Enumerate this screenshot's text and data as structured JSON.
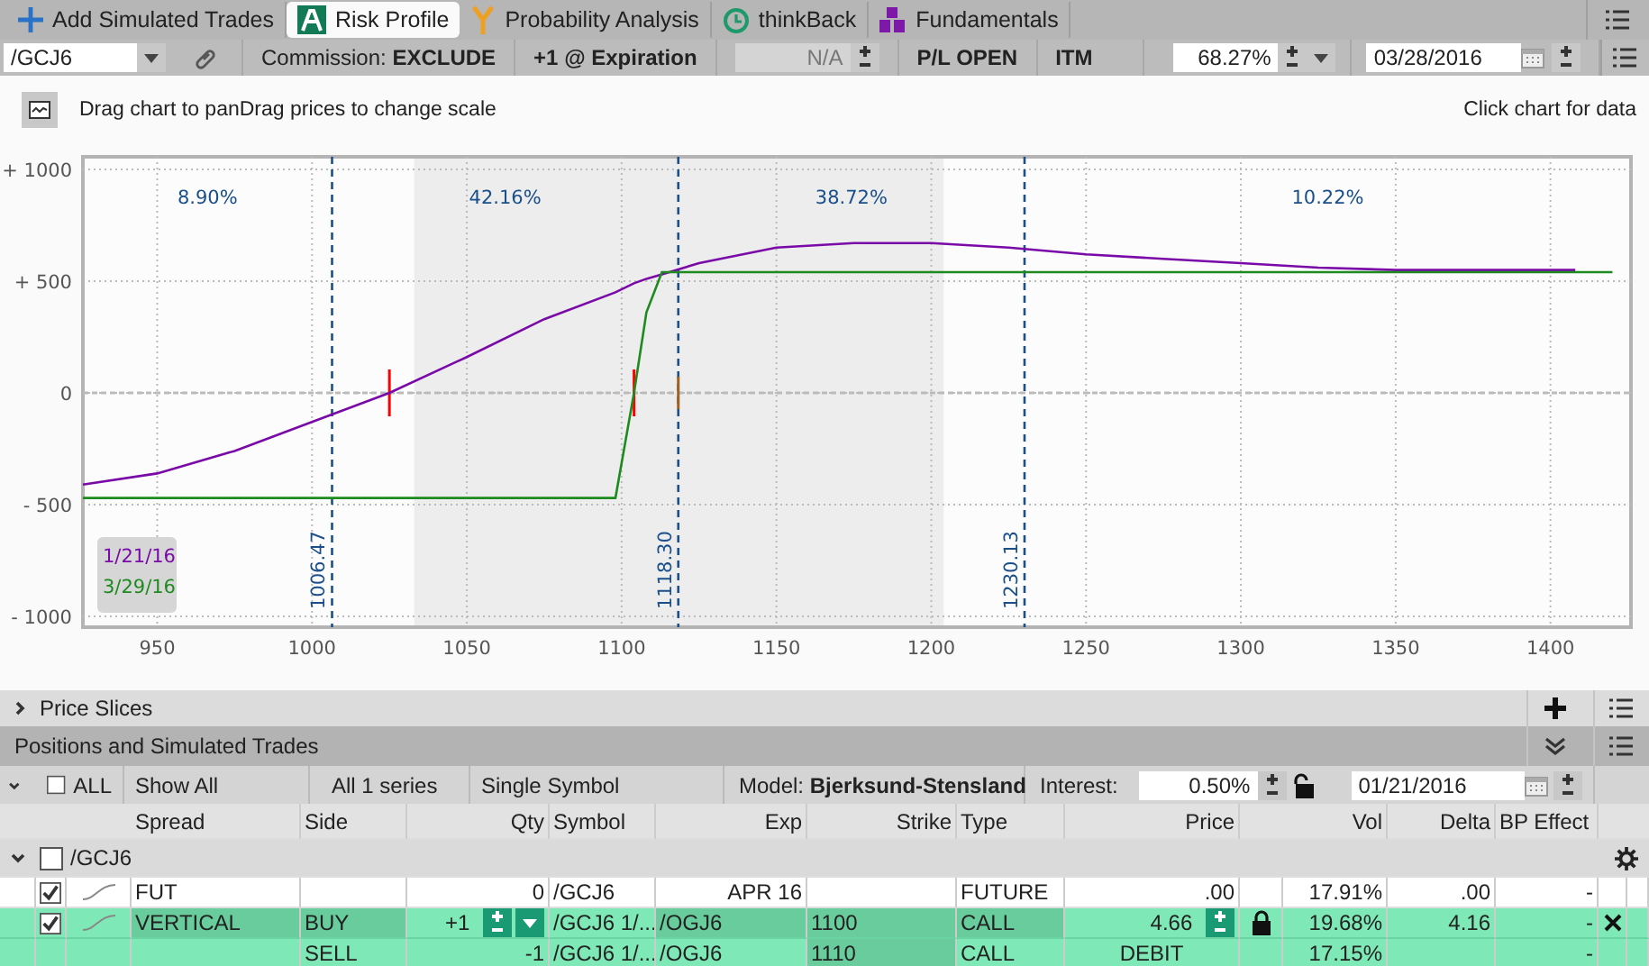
{
  "add_button": {
    "label": "Add Simulated Trades"
  },
  "tabs": [
    {
      "label": "Risk Profile",
      "selected": true
    },
    {
      "label": "Probability Analysis",
      "selected": false
    },
    {
      "label": "thinkBack",
      "selected": false
    },
    {
      "label": "Fundamentals",
      "selected": false
    }
  ],
  "toolbar": {
    "symbol": {
      "value": "/GCJ6"
    },
    "commission": {
      "label": "Commission:",
      "value": "EXCLUDE"
    },
    "expiration": "+1 @ Expiration",
    "offset": {
      "value": "N/A",
      "disabled": true
    },
    "pl_mode": "P/L OPEN",
    "itm": "ITM",
    "probability": {
      "value": "68.27%"
    },
    "date": {
      "value": "03/28/2016"
    }
  },
  "chart": {
    "hint": "Drag chart to panDrag prices to change scale",
    "click_hint": "Click chart for data",
    "chart_data": {
      "type": "line",
      "x": [
        926,
        950,
        975,
        1000,
        1025,
        1050,
        1075,
        1098,
        1104,
        1108,
        1113,
        1125,
        1150,
        1175,
        1200,
        1225,
        1250,
        1275,
        1300,
        1325,
        1350,
        1375,
        1408,
        1420
      ],
      "series": [
        {
          "name": "1/21/16",
          "color": "#7a0aa8",
          "values": [
            -410,
            -360,
            -260,
            -130,
            0,
            160,
            330,
            450,
            490,
            510,
            530,
            580,
            650,
            670,
            670,
            650,
            620,
            600,
            580,
            560,
            550,
            550,
            550,
            null
          ]
        },
        {
          "name": "3/29/16",
          "color": "#1f8a1f",
          "values": [
            -470,
            -470,
            -470,
            -470,
            -470,
            -470,
            -470,
            -470,
            0,
            360,
            540,
            540,
            540,
            540,
            540,
            540,
            540,
            540,
            540,
            540,
            540,
            540,
            540,
            540
          ]
        }
      ],
      "xlim": [
        926,
        1426
      ],
      "ylim": [
        -1048,
        1056
      ],
      "xticks": [
        950,
        1000,
        1050,
        1100,
        1150,
        1200,
        1250,
        1300,
        1350,
        1400
      ],
      "yticks": [
        {
          "value": 1000,
          "label": "+ 1000"
        },
        {
          "value": 500,
          "label": "+ 500"
        },
        {
          "value": 0,
          "label": "0"
        },
        {
          "value": -500,
          "label": "- 500"
        },
        {
          "value": -1000,
          "label": "- 1000"
        }
      ],
      "grid": true,
      "bands": [
        {
          "axis": "x",
          "from": 1033,
          "to": 1204
        }
      ],
      "ref_lines": [
        {
          "axis": "y",
          "value": 0
        },
        {
          "axis": "x",
          "value": 1006.47,
          "label": "1006.47"
        },
        {
          "axis": "x",
          "value": 1118.3,
          "label": "1118.30"
        },
        {
          "axis": "x",
          "value": 1230.13,
          "label": "1230.13"
        }
      ],
      "annotations": [
        "8.90%",
        "42.16%",
        "38.72%",
        "10.22%"
      ]
    }
  },
  "price_slices": {
    "title": "Price Slices",
    "expanded": false
  },
  "positions": {
    "title": "Positions and Simulated Trades",
    "filters": {
      "all": {
        "label": "ALL",
        "checked": false
      },
      "show": "Show All",
      "series": "All 1 series",
      "symbol_mode": "Single Symbol",
      "model_label": "Model:",
      "model": "Bjerksund-Stensland",
      "interest_label": "Interest:",
      "interest": {
        "value": "0.50%"
      },
      "interest_locked": false,
      "date": {
        "value": "01/21/2016"
      }
    },
    "columns": [
      "Spread",
      "Side",
      "Qty",
      "Symbol",
      "Exp",
      "Strike",
      "Type",
      "Price",
      "Vol",
      "Delta",
      "BP Effect"
    ],
    "group": {
      "label": "/GCJ6",
      "expanded": true,
      "checked": false
    },
    "rows": [
      {
        "kind": "position",
        "checked": true,
        "spread": "FUT",
        "side": "",
        "qty": "0",
        "symbol": "/GCJ6",
        "exp": "APR 16",
        "strike": "",
        "type": "FUTURE",
        "price": ".00",
        "locked": false,
        "vol": "17.91%",
        "delta": ".00",
        "bp": "-",
        "removable": false
      },
      {
        "kind": "spread",
        "checked": true,
        "spread": "VERTICAL",
        "side": "BUY",
        "qty": "+1",
        "symbol": "/GCJ6 1/...",
        "exp": "/OGJ6",
        "strike": "1100",
        "type": "CALL",
        "price": "4.66",
        "locked": true,
        "vol": "19.68%",
        "delta": "4.16",
        "bp": "-",
        "removable": true
      },
      {
        "kind": "leg",
        "side": "SELL",
        "qty": "-1",
        "symbol": "/GCJ6 1/...",
        "exp": "/OGJ6",
        "strike": "1110",
        "type": "CALL",
        "price": "DEBIT",
        "locked": false,
        "vol": "17.15%",
        "delta": "",
        "bp": "-",
        "removable": false
      }
    ]
  }
}
